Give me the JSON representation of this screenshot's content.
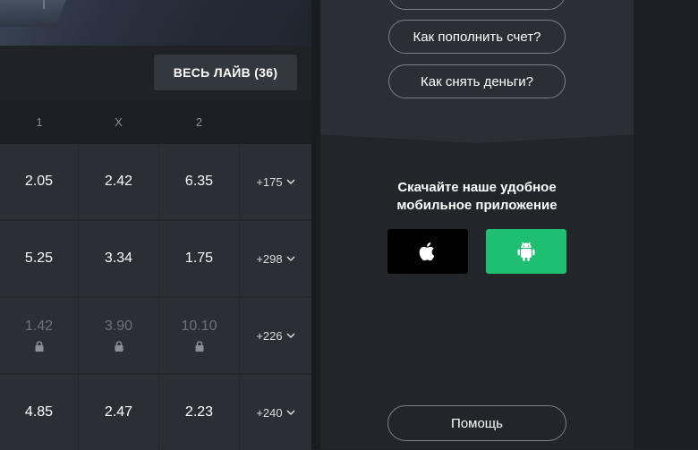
{
  "live_button": "ВЕСЬ ЛАЙВ (36)",
  "odds_header": [
    "1",
    "X",
    "2"
  ],
  "rows": [
    {
      "odds": [
        "2.05",
        "2.42",
        "6.35"
      ],
      "more": "+175",
      "locked": false
    },
    {
      "odds": [
        "5.25",
        "3.34",
        "1.75"
      ],
      "more": "+298",
      "locked": false
    },
    {
      "odds": [
        "1.42",
        "3.90",
        "10.10"
      ],
      "more": "+226",
      "locked": true
    },
    {
      "odds": [
        "4.85",
        "2.47",
        "2.23"
      ],
      "more": "+240",
      "locked": false
    }
  ],
  "panel": {
    "faq": [
      "Как пополнить счет?",
      "Как снять деньги?"
    ],
    "download_line1": "Скачайте наше удобное",
    "download_line2": "мобильное приложение",
    "help_button": "Помощь"
  },
  "colors": {
    "android_green": "#1fbf72",
    "apple_black": "#000000"
  },
  "icons": {
    "apple": "apple-icon",
    "android": "android-icon",
    "lock": "lock-icon",
    "chevron": "chevron-down-icon"
  }
}
